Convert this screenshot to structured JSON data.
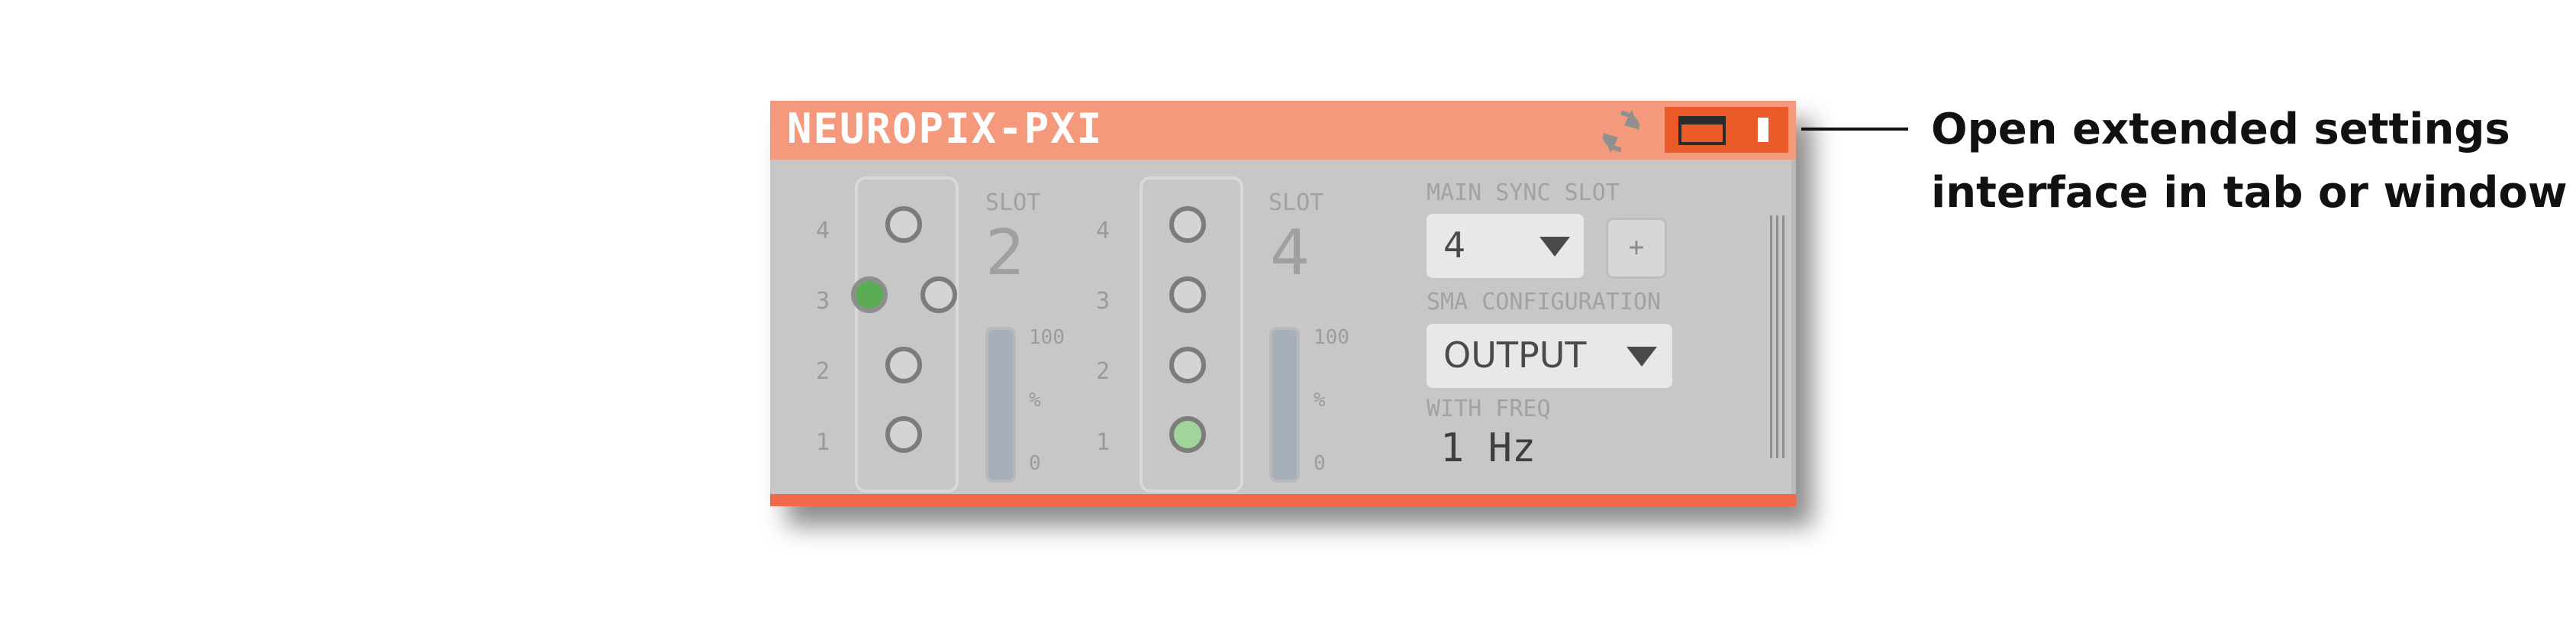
{
  "plugin": {
    "title": "NEUROPIX-PXI",
    "header_icons": [
      "refresh-icon",
      "window-icon",
      "tab-icon"
    ],
    "accent_color": "#f5997c",
    "button_color": "#ec5a2a"
  },
  "slots": [
    {
      "slot_label": "SLOT",
      "slot_number": "2",
      "row_labels": [
        "4",
        "3",
        "2",
        "1"
      ],
      "ports": [
        {
          "row": "4",
          "state": "empty"
        },
        {
          "row": "3",
          "state": "connected"
        },
        {
          "row": "3",
          "state": "empty"
        },
        {
          "row": "2",
          "state": "empty"
        },
        {
          "row": "1",
          "state": "empty"
        }
      ],
      "fill_scale": {
        "max": "100",
        "unit": "%",
        "min": "0"
      },
      "fill_level": 0
    },
    {
      "slot_label": "SLOT",
      "slot_number": "4",
      "row_labels": [
        "4",
        "3",
        "2",
        "1"
      ],
      "ports": [
        {
          "row": "4",
          "state": "empty"
        },
        {
          "row": "3",
          "state": "empty"
        },
        {
          "row": "2",
          "state": "empty"
        },
        {
          "row": "1",
          "state": "connected-dim"
        }
      ],
      "fill_scale": {
        "max": "100",
        "unit": "%",
        "min": "0"
      },
      "fill_level": 0
    }
  ],
  "settings": {
    "main_sync_label": "MAIN SYNC SLOT",
    "main_sync_value": "4",
    "plus_label": "+",
    "sma_label": "SMA CONFIGURATION",
    "sma_value": "OUTPUT",
    "freq_label": "WITH FREQ",
    "freq_value": "1 Hz"
  },
  "annotation": {
    "line1": "Open extended settings",
    "line2": "interface in tab or window"
  }
}
